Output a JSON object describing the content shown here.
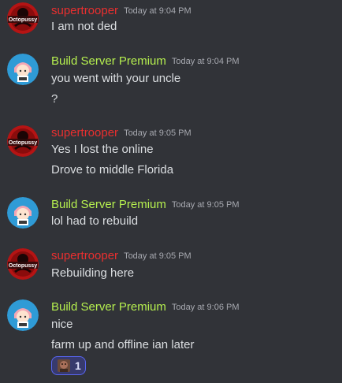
{
  "users": {
    "super": {
      "name": "supertrooper",
      "color": "#e92f2f",
      "avatar_text": "Octopussy",
      "avatar_icon": "red-octopussy-avatar"
    },
    "build": {
      "name": "Build Server Premium",
      "color": "#b6f04f",
      "avatar_icon": "anime-character-avatar"
    }
  },
  "messages": [
    {
      "author": "supertrooper",
      "time": "Today at 9:04 PM",
      "lines": [
        "I am not ded"
      ]
    },
    {
      "author": "Build Server Premium",
      "time": "Today at 9:04 PM",
      "lines": [
        "you went with your uncle",
        "?"
      ]
    },
    {
      "author": "supertrooper",
      "time": "Today at 9:05 PM",
      "lines": [
        "Yes I lost the online",
        "Drove to middle Florida"
      ]
    },
    {
      "author": "Build Server Premium",
      "time": "Today at 9:05 PM",
      "lines": [
        "lol had to rebuild"
      ]
    },
    {
      "author": "supertrooper",
      "time": "Today at 9:05 PM",
      "lines": [
        "Rebuilding here"
      ]
    },
    {
      "author": "Build Server Premium",
      "time": "Today at 9:06 PM",
      "lines": [
        "nice",
        "farm up and offline ian later"
      ],
      "reaction": {
        "emoji": "custom-emoji-brown-face",
        "count": "1"
      }
    }
  ]
}
